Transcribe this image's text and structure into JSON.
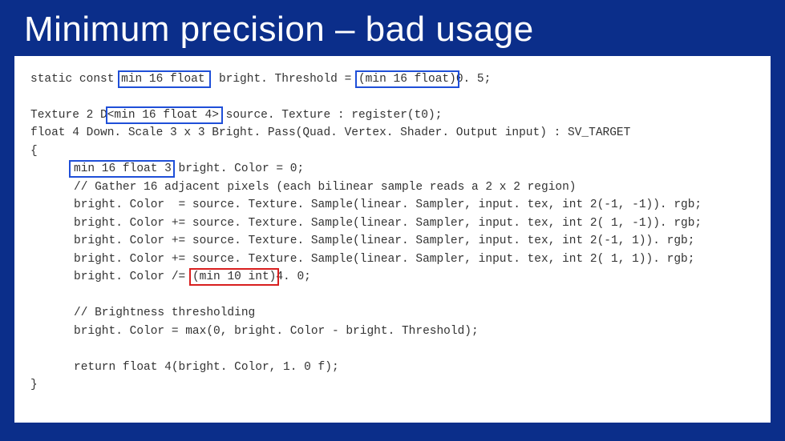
{
  "title": "Minimum precision – bad usage",
  "code": {
    "l0a": "static const ",
    "l0_kw1": "min 16 float",
    "l0b": "  bright. Threshold = ",
    "l0_kw2": "(min 16 float)",
    "l0c": "0. 5;",
    "blank1": " ",
    "l1a": "Texture 2 D",
    "l1_kw": "<min 16 float 4>",
    "l1b": " source. Texture : register(t0);",
    "l2": "float 4 Down. Scale 3 x 3 Bright. Pass(Quad. Vertex. Shader. Output input) : SV_TARGET",
    "l3": "{",
    "l4a": "min 16 float 3",
    "l4b": " bright. Color = 0;",
    "l5": "// Gather 16 adjacent pixels (each bilinear sample reads a 2 x 2 region)",
    "l6": "bright. Color  = source. Texture. Sample(linear. Sampler, input. tex, int 2(-1, -1)). rgb;",
    "l7": "bright. Color += source. Texture. Sample(linear. Sampler, input. tex, int 2( 1, -1)). rgb;",
    "l8": "bright. Color += source. Texture. Sample(linear. Sampler, input. tex, int 2(-1, 1)). rgb;",
    "l9": "bright. Color += source. Texture. Sample(linear. Sampler, input. tex, int 2( 1, 1)). rgb;",
    "l10a": "bright. Color /= ",
    "l10_kw": "(min 10 int)",
    "l10b": "4. 0;",
    "blank2": " ",
    "l11": "// Brightness thresholding",
    "l12": "bright. Color = max(0, bright. Color - bright. Threshold);",
    "blank3": " ",
    "l13": "return float 4(bright. Color, 1. 0 f);",
    "l14": "}"
  }
}
